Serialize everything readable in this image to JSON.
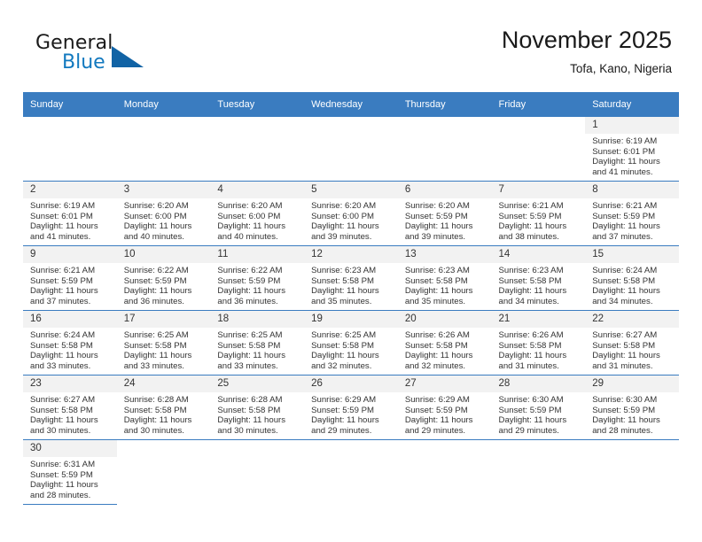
{
  "brand": {
    "word1": "General",
    "word2": "Blue",
    "mark_icon": "triangle-mark-icon",
    "accent_color": "#1279bf"
  },
  "header": {
    "title": "November 2025",
    "subtitle": "Tofa, Kano, Nigeria"
  },
  "colors": {
    "header_row_bg": "#3a7cc0",
    "daynum_bg": "#f2f2f2",
    "grid_line": "#3a7cc0",
    "text": "#333333"
  },
  "calendar": {
    "weekday_headers": [
      "Sunday",
      "Monday",
      "Tuesday",
      "Wednesday",
      "Thursday",
      "Friday",
      "Saturday"
    ],
    "weeks": [
      [
        {
          "empty": true
        },
        {
          "empty": true
        },
        {
          "empty": true
        },
        {
          "empty": true
        },
        {
          "empty": true
        },
        {
          "empty": true
        },
        {
          "day": "1",
          "sunrise": "Sunrise: 6:19 AM",
          "sunset": "Sunset: 6:01 PM",
          "daylight": "Daylight: 11 hours and 41 minutes."
        }
      ],
      [
        {
          "day": "2",
          "sunrise": "Sunrise: 6:19 AM",
          "sunset": "Sunset: 6:01 PM",
          "daylight": "Daylight: 11 hours and 41 minutes."
        },
        {
          "day": "3",
          "sunrise": "Sunrise: 6:20 AM",
          "sunset": "Sunset: 6:00 PM",
          "daylight": "Daylight: 11 hours and 40 minutes."
        },
        {
          "day": "4",
          "sunrise": "Sunrise: 6:20 AM",
          "sunset": "Sunset: 6:00 PM",
          "daylight": "Daylight: 11 hours and 40 minutes."
        },
        {
          "day": "5",
          "sunrise": "Sunrise: 6:20 AM",
          "sunset": "Sunset: 6:00 PM",
          "daylight": "Daylight: 11 hours and 39 minutes."
        },
        {
          "day": "6",
          "sunrise": "Sunrise: 6:20 AM",
          "sunset": "Sunset: 5:59 PM",
          "daylight": "Daylight: 11 hours and 39 minutes."
        },
        {
          "day": "7",
          "sunrise": "Sunrise: 6:21 AM",
          "sunset": "Sunset: 5:59 PM",
          "daylight": "Daylight: 11 hours and 38 minutes."
        },
        {
          "day": "8",
          "sunrise": "Sunrise: 6:21 AM",
          "sunset": "Sunset: 5:59 PM",
          "daylight": "Daylight: 11 hours and 37 minutes."
        }
      ],
      [
        {
          "day": "9",
          "sunrise": "Sunrise: 6:21 AM",
          "sunset": "Sunset: 5:59 PM",
          "daylight": "Daylight: 11 hours and 37 minutes."
        },
        {
          "day": "10",
          "sunrise": "Sunrise: 6:22 AM",
          "sunset": "Sunset: 5:59 PM",
          "daylight": "Daylight: 11 hours and 36 minutes."
        },
        {
          "day": "11",
          "sunrise": "Sunrise: 6:22 AM",
          "sunset": "Sunset: 5:59 PM",
          "daylight": "Daylight: 11 hours and 36 minutes."
        },
        {
          "day": "12",
          "sunrise": "Sunrise: 6:23 AM",
          "sunset": "Sunset: 5:58 PM",
          "daylight": "Daylight: 11 hours and 35 minutes."
        },
        {
          "day": "13",
          "sunrise": "Sunrise: 6:23 AM",
          "sunset": "Sunset: 5:58 PM",
          "daylight": "Daylight: 11 hours and 35 minutes."
        },
        {
          "day": "14",
          "sunrise": "Sunrise: 6:23 AM",
          "sunset": "Sunset: 5:58 PM",
          "daylight": "Daylight: 11 hours and 34 minutes."
        },
        {
          "day": "15",
          "sunrise": "Sunrise: 6:24 AM",
          "sunset": "Sunset: 5:58 PM",
          "daylight": "Daylight: 11 hours and 34 minutes."
        }
      ],
      [
        {
          "day": "16",
          "sunrise": "Sunrise: 6:24 AM",
          "sunset": "Sunset: 5:58 PM",
          "daylight": "Daylight: 11 hours and 33 minutes."
        },
        {
          "day": "17",
          "sunrise": "Sunrise: 6:25 AM",
          "sunset": "Sunset: 5:58 PM",
          "daylight": "Daylight: 11 hours and 33 minutes."
        },
        {
          "day": "18",
          "sunrise": "Sunrise: 6:25 AM",
          "sunset": "Sunset: 5:58 PM",
          "daylight": "Daylight: 11 hours and 33 minutes."
        },
        {
          "day": "19",
          "sunrise": "Sunrise: 6:25 AM",
          "sunset": "Sunset: 5:58 PM",
          "daylight": "Daylight: 11 hours and 32 minutes."
        },
        {
          "day": "20",
          "sunrise": "Sunrise: 6:26 AM",
          "sunset": "Sunset: 5:58 PM",
          "daylight": "Daylight: 11 hours and 32 minutes."
        },
        {
          "day": "21",
          "sunrise": "Sunrise: 6:26 AM",
          "sunset": "Sunset: 5:58 PM",
          "daylight": "Daylight: 11 hours and 31 minutes."
        },
        {
          "day": "22",
          "sunrise": "Sunrise: 6:27 AM",
          "sunset": "Sunset: 5:58 PM",
          "daylight": "Daylight: 11 hours and 31 minutes."
        }
      ],
      [
        {
          "day": "23",
          "sunrise": "Sunrise: 6:27 AM",
          "sunset": "Sunset: 5:58 PM",
          "daylight": "Daylight: 11 hours and 30 minutes."
        },
        {
          "day": "24",
          "sunrise": "Sunrise: 6:28 AM",
          "sunset": "Sunset: 5:58 PM",
          "daylight": "Daylight: 11 hours and 30 minutes."
        },
        {
          "day": "25",
          "sunrise": "Sunrise: 6:28 AM",
          "sunset": "Sunset: 5:58 PM",
          "daylight": "Daylight: 11 hours and 30 minutes."
        },
        {
          "day": "26",
          "sunrise": "Sunrise: 6:29 AM",
          "sunset": "Sunset: 5:59 PM",
          "daylight": "Daylight: 11 hours and 29 minutes."
        },
        {
          "day": "27",
          "sunrise": "Sunrise: 6:29 AM",
          "sunset": "Sunset: 5:59 PM",
          "daylight": "Daylight: 11 hours and 29 minutes."
        },
        {
          "day": "28",
          "sunrise": "Sunrise: 6:30 AM",
          "sunset": "Sunset: 5:59 PM",
          "daylight": "Daylight: 11 hours and 29 minutes."
        },
        {
          "day": "29",
          "sunrise": "Sunrise: 6:30 AM",
          "sunset": "Sunset: 5:59 PM",
          "daylight": "Daylight: 11 hours and 28 minutes."
        }
      ],
      [
        {
          "day": "30",
          "sunrise": "Sunrise: 6:31 AM",
          "sunset": "Sunset: 5:59 PM",
          "daylight": "Daylight: 11 hours and 28 minutes."
        },
        {
          "blank": true
        },
        {
          "blank": true
        },
        {
          "blank": true
        },
        {
          "blank": true
        },
        {
          "blank": true
        },
        {
          "blank": true
        }
      ]
    ]
  }
}
